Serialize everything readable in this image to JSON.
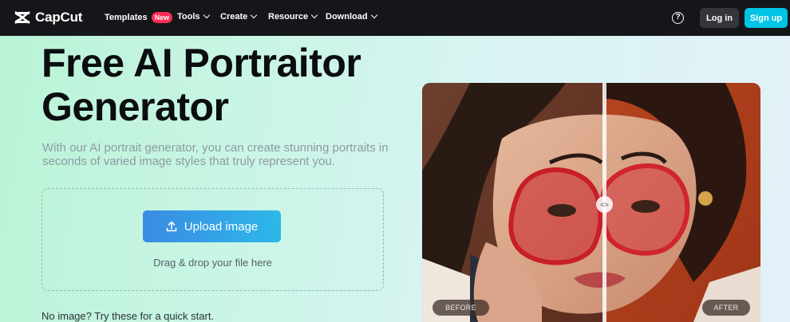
{
  "nav": {
    "logo_text": "CapCut",
    "items": [
      {
        "label": "Templates",
        "badge": "New"
      },
      {
        "label": "Tools"
      },
      {
        "label": "Create"
      },
      {
        "label": "Resource"
      },
      {
        "label": "Download"
      }
    ],
    "help_icon": "question-circle-icon",
    "login_label": "Log in",
    "signup_label": "Sign up"
  },
  "hero": {
    "title": "Free AI Portraitor Generator",
    "subtitle": "With our AI portrait generator, you can create stunning portraits in seconds of varied image styles that truly represent you.",
    "upload_label": "Upload image",
    "upload_icon": "upload-icon",
    "drag_text": "Drag & drop your file here",
    "no_image_text": "No image? Try these for a quick start."
  },
  "preview": {
    "before_label": "BEFORE",
    "after_label": "AFTER",
    "handle_icon": "compare-arrows-icon"
  },
  "colors": {
    "nav_bg": "#15161a",
    "signup_bg": "#00c4e4",
    "badge_bg": "#fe2c55",
    "upload_gradient_start": "#3b8be3",
    "upload_gradient_end": "#2db8e9"
  }
}
